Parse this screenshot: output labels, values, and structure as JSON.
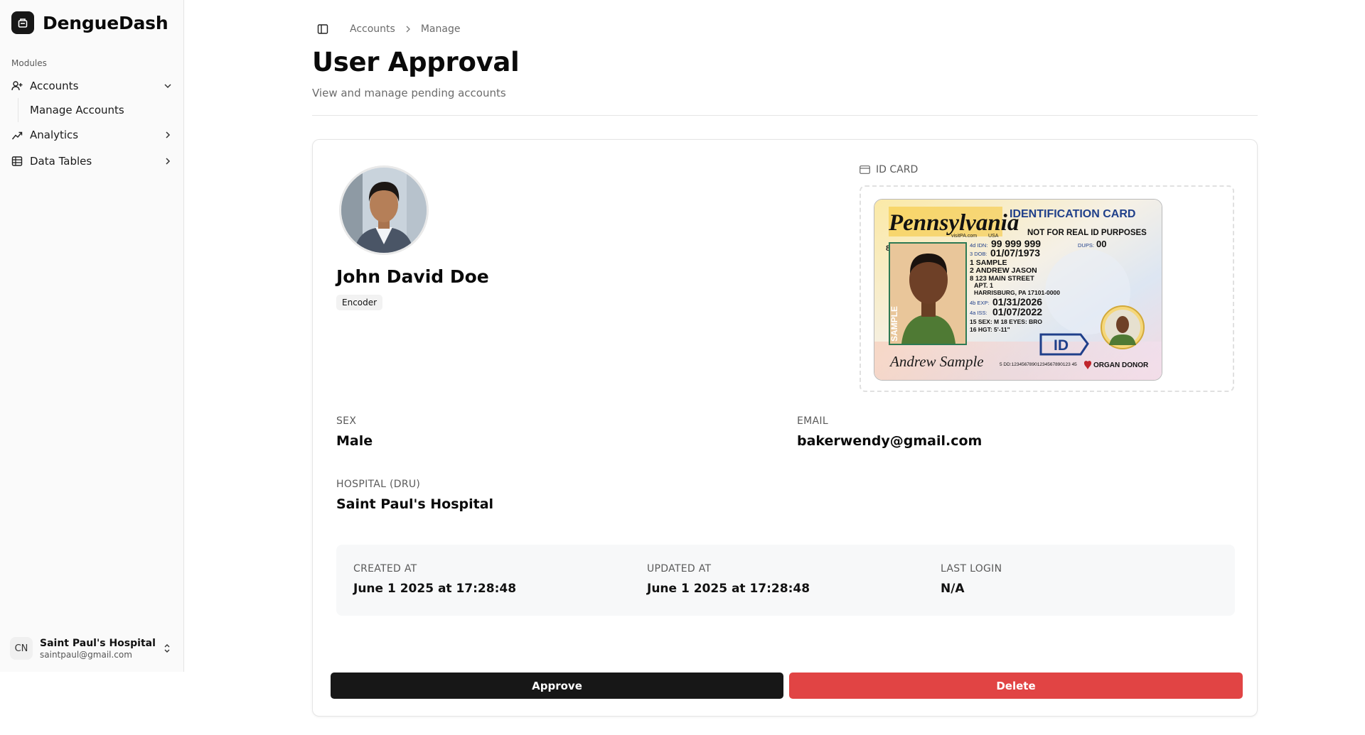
{
  "sidebar": {
    "brand": "DengueDash",
    "group_label": "Modules",
    "items": [
      {
        "label": "Accounts",
        "icon": "user-plus-icon",
        "expanded": true
      },
      {
        "label": "Analytics",
        "icon": "trend-icon",
        "expanded": false
      },
      {
        "label": "Data Tables",
        "icon": "table-icon",
        "expanded": false
      }
    ],
    "subitems": [
      {
        "label": "Manage Accounts"
      }
    ],
    "user": {
      "initials": "CN",
      "name": "Saint Paul's Hospital",
      "email": "saintpaul@gmail.com"
    }
  },
  "breadcrumb": [
    "Accounts",
    "Manage"
  ],
  "page": {
    "title": "User Approval",
    "subtitle": "View and manage pending accounts"
  },
  "profile": {
    "name": "John David Doe",
    "role": "Encoder",
    "id_card_label": "ID CARD",
    "fields": {
      "sex": {
        "label": "SEX",
        "value": "Male"
      },
      "email": {
        "label": "EMAIL",
        "value": "bakerwendy@gmail.com"
      },
      "hospital": {
        "label": "HOSPITAL (DRU)",
        "value": "Saint Paul's Hospital"
      }
    },
    "meta": [
      {
        "label": "CREATED AT",
        "value": "June 1 2025 at 17:28:48"
      },
      {
        "label": "UPDATED AT",
        "value": "June 1 2025 at 17:28:48"
      },
      {
        "label": "LAST LOGIN",
        "value": "N/A"
      }
    ]
  },
  "id_card": {
    "state": "Pennsylvania",
    "state_site": "visitPA.com",
    "country": "USA",
    "card_title": "IDENTIFICATION CARD",
    "disclaimer": "NOT FOR REAL ID PURPOSES",
    "idn_label": "4d IDN:",
    "idn": "99 999 999",
    "dups_label": "DUPS:",
    "dups": "00",
    "dob_label": "3 DOB:",
    "dob": "01/07/1973",
    "surname": "1 SAMPLE",
    "given": "2 ANDREW JASON",
    "addr1": "8 123 MAIN STREET",
    "addr2": "APT. 1",
    "addr3": "HARRISBURG, PA 17101-0000",
    "exp_label": "4b EXP:",
    "exp": "01/31/2026",
    "iss_label": "4a ISS:",
    "iss": "01/07/2022",
    "sex_line": "15 SEX: M  18 EYES: BRO",
    "hgt_line": "16 HGT: 5'-11\"",
    "signature": "Andrew Sample",
    "dd": "5 DD:12345678901234567890123 45",
    "id_badge": "ID",
    "organ": "ORGAN DONOR",
    "sample": "SAMPLE",
    "side_number": "8"
  },
  "actions": {
    "approve": "Approve",
    "delete": "Delete"
  },
  "colors": {
    "primary": "#171717",
    "danger": "#e14444",
    "sidebar_bg": "#fafafa"
  }
}
